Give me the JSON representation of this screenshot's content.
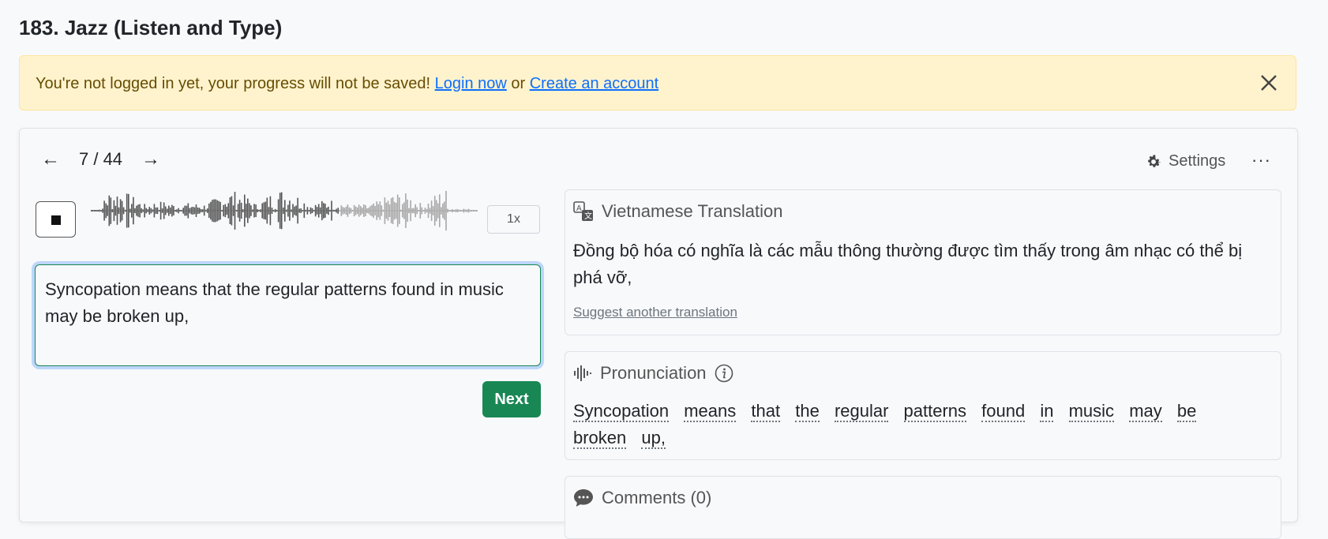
{
  "page": {
    "title": "183. Jazz (Listen and Type)"
  },
  "alert": {
    "message": "You're not logged in yet, your progress will not be saved!",
    "login_link": "Login now",
    "or_text": "or",
    "create_link": "Create an account"
  },
  "nav": {
    "prev": "←",
    "counter": "7 / 44",
    "next": "→"
  },
  "toolbar": {
    "settings_label": "Settings",
    "more_label": "···"
  },
  "player": {
    "speed": "1x",
    "progress": 0.64
  },
  "answer": {
    "value": "Syncopation means that the regular patterns found in music may be broken up,"
  },
  "next_button": "Next",
  "translation": {
    "heading": "Vietnamese Translation",
    "text": "Đồng bộ hóa có nghĩa là các mẫu thông thường được tìm thấy trong âm nhạc có thể bị phá vỡ,",
    "suggest_link": "Suggest another translation"
  },
  "pronunciation": {
    "heading": "Pronunciation",
    "words": [
      "Syncopation",
      "means",
      "that",
      "the",
      "regular",
      "patterns",
      "found",
      "in",
      "music",
      "may",
      "be",
      "broken",
      "up,"
    ]
  },
  "comments": {
    "heading": "Comments (0)"
  },
  "colors": {
    "accent": "#198754",
    "alert_bg": "#fff3cd",
    "link": "#0d6efd"
  }
}
